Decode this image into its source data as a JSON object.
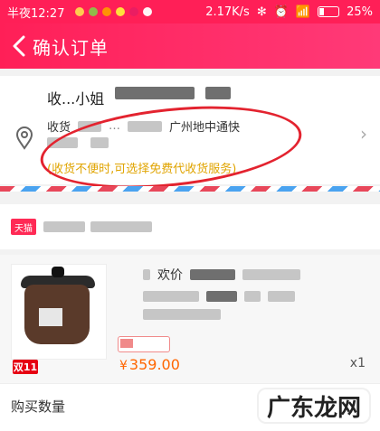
{
  "status_bar": {
    "time": "半夜12:27",
    "speed": "2.17K/s",
    "battery": "25%"
  },
  "header": {
    "title": "确认订单"
  },
  "address": {
    "name": "收...小姐",
    "line1": "收货",
    "line1_tail": "广州地中通快",
    "line2": "",
    "hint": "(收货不便时,可选择免费代收货服务)"
  },
  "shop": {
    "badge": "天猫"
  },
  "item": {
    "title_prefix": "欢价",
    "sale_badge": "双11",
    "price_currency": "¥",
    "price": "359.00",
    "quantity": "x1"
  },
  "bottom": {
    "buy_qty_label": "购买数量"
  },
  "watermark": {
    "text": "广东龙网"
  },
  "colors": {
    "brand_red": "#ff1f57",
    "price_orange": "#ff6600",
    "hint_yellow": "#e0a400",
    "annotation_red": "#e3232f"
  }
}
